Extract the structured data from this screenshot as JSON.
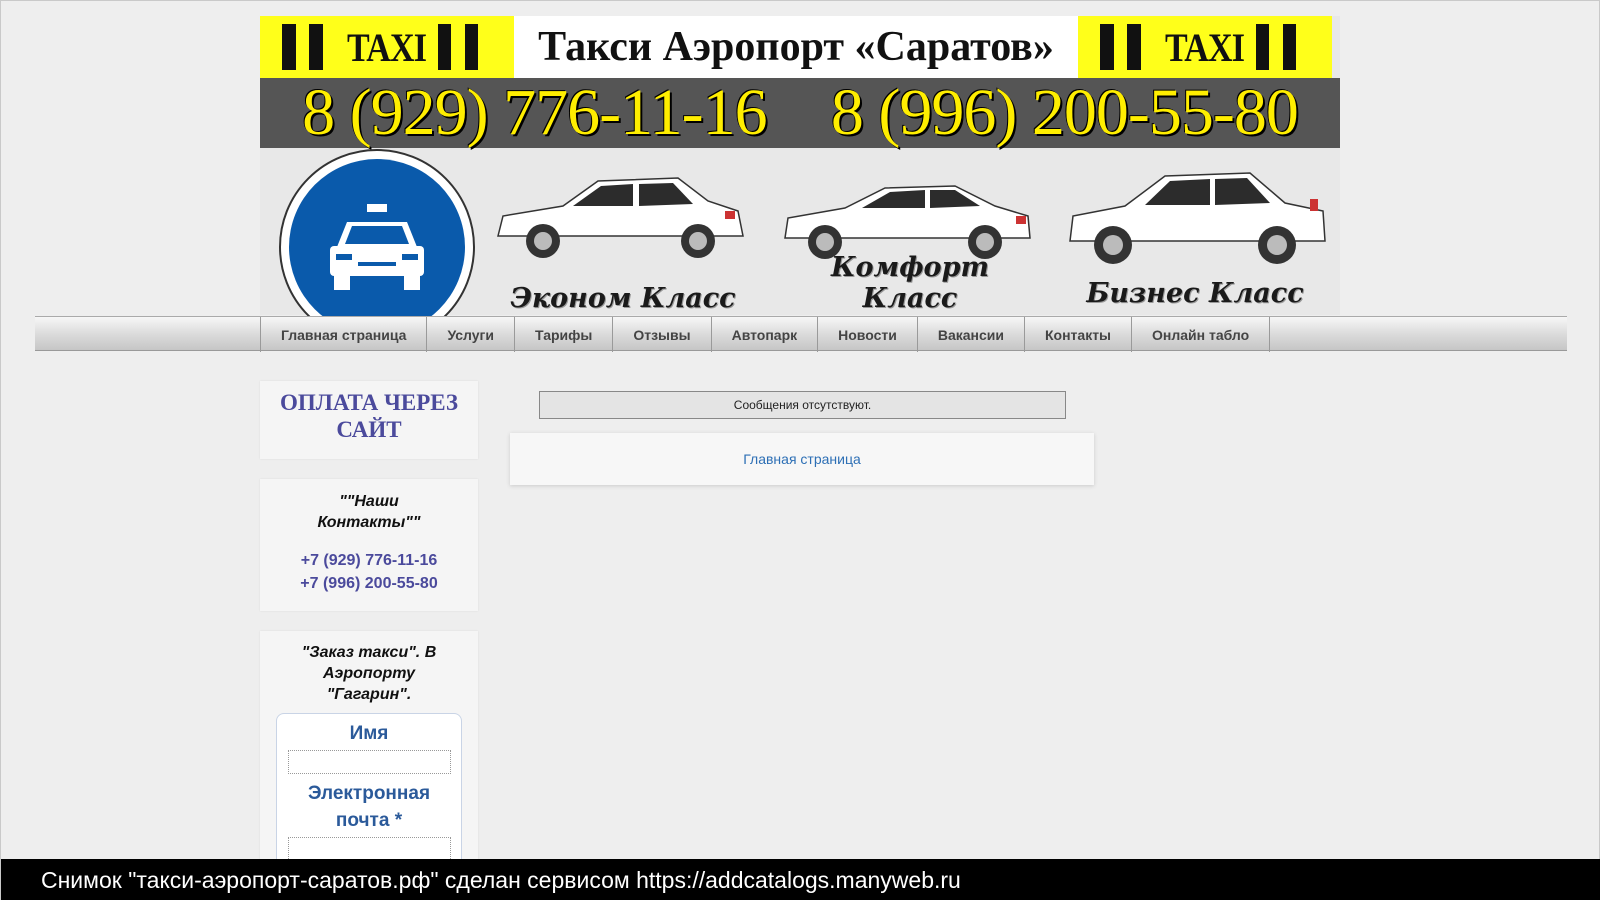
{
  "header": {
    "taxi_word": "TAXI",
    "title": "Такси Аэропорт «Саратов»",
    "phone_1": "8 (929) 776-11-16",
    "phone_2": "8 (996) 200-55-80",
    "sign_icon": "taxi-road-sign-icon",
    "car_classes": [
      {
        "label": "Эконом Класс"
      },
      {
        "label": "Комфорт Класс"
      },
      {
        "label": "Бизнес Класс"
      }
    ]
  },
  "nav": {
    "items": [
      {
        "label": "Главная страница"
      },
      {
        "label": "Услуги"
      },
      {
        "label": "Тарифы"
      },
      {
        "label": "Отзывы"
      },
      {
        "label": "Автопарк"
      },
      {
        "label": "Новости"
      },
      {
        "label": "Вакансии"
      },
      {
        "label": "Контакты"
      },
      {
        "label": "Онлайн табло"
      }
    ]
  },
  "sidebar": {
    "pay_link": "ОПЛАТА ЧЕРЕЗ САЙТ",
    "contacts_title": "\"\"Наши Контакты\"\"",
    "phones": [
      "+7 (929) 776-11-16",
      "+7 (996) 200-55-80"
    ],
    "order_title": "\"Заказ такси\". В Аэропорту \"Гагарин\".",
    "form": {
      "name_label": "Имя",
      "email_label": "Электронная почта *"
    }
  },
  "main": {
    "messages": "Сообщения отсутствуют.",
    "breadcrumb": "Главная страница"
  },
  "footer": {
    "watermark": "Снимок \"такси-аэропорт-саратов.рф\" сделан сервисом https://addcatalogs.manyweb.ru"
  },
  "colors": {
    "taxi_yellow": "#ffff1a",
    "phone_yellow": "#ffee00",
    "sign_blue": "#0a5aab",
    "link_purple": "#4b4a9c",
    "form_blue": "#2b5a9a"
  }
}
